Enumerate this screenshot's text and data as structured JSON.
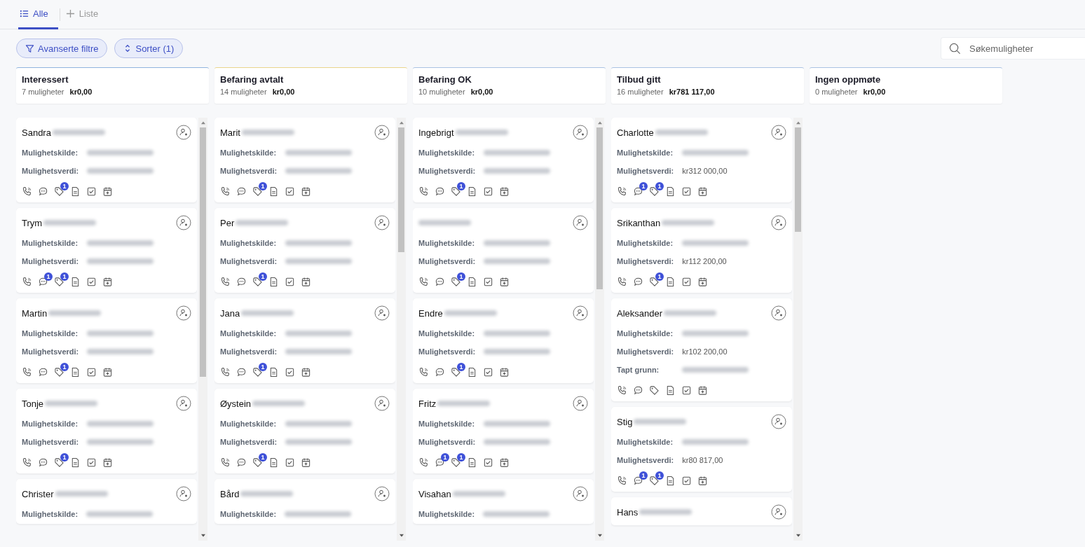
{
  "tabs": [
    {
      "label": "Alle",
      "kind": "list",
      "selected": true
    },
    {
      "label": "Liste",
      "kind": "add",
      "selected": false
    }
  ],
  "toolbar": {
    "buttons": [
      {
        "label": "Avanserte filtre",
        "kind": "filter"
      },
      {
        "label": "Sorter (1)",
        "kind": "sort"
      }
    ],
    "search": {
      "placeholder": "Søkemuligheter"
    }
  },
  "columns": [
    {
      "title": "Interessert",
      "count": "7 muligheter",
      "total": "kr0,00",
      "color": "#8fb4de",
      "cards": [
        {
          "name": "Sandra",
          "fields": [
            {
              "label": "Mulighetskilde:"
            },
            {
              "label": "Mulighetsverdi:"
            }
          ],
          "actions": [
            {
              "kind": "call"
            },
            {
              "kind": "chat"
            },
            {
              "kind": "tag",
              "badge": "1"
            },
            {
              "kind": "note"
            },
            {
              "kind": "task"
            },
            {
              "kind": "event"
            }
          ]
        },
        {
          "name": "Trym",
          "fields": [
            {
              "label": "Mulighetskilde:"
            },
            {
              "label": "Mulighetsverdi:"
            }
          ],
          "actions": [
            {
              "kind": "call"
            },
            {
              "kind": "chat",
              "badge": "1"
            },
            {
              "kind": "tag",
              "badge": "1"
            },
            {
              "kind": "note"
            },
            {
              "kind": "task"
            },
            {
              "kind": "event"
            }
          ]
        },
        {
          "name": "Martin",
          "fields": [
            {
              "label": "Mulighetskilde:"
            },
            {
              "label": "Mulighetsverdi:"
            }
          ],
          "actions": [
            {
              "kind": "call"
            },
            {
              "kind": "chat"
            },
            {
              "kind": "tag",
              "badge": "1"
            },
            {
              "kind": "note"
            },
            {
              "kind": "task"
            },
            {
              "kind": "event"
            }
          ]
        },
        {
          "name": "Tonje",
          "fields": [
            {
              "label": "Mulighetskilde:"
            },
            {
              "label": "Mulighetsverdi:"
            }
          ],
          "actions": [
            {
              "kind": "call"
            },
            {
              "kind": "chat"
            },
            {
              "kind": "tag",
              "badge": "1"
            },
            {
              "kind": "note"
            },
            {
              "kind": "task"
            },
            {
              "kind": "event"
            }
          ]
        },
        {
          "name": "Christer",
          "fields": [
            {
              "label": "Mulighetskilde:"
            }
          ]
        }
      ]
    },
    {
      "title": "Befaring avtalt",
      "count": "14 muligheter",
      "total": "kr0,00",
      "color": "#e9d58c",
      "cards": [
        {
          "name": "Marit",
          "fields": [
            {
              "label": "Mulighetskilde:"
            },
            {
              "label": "Mulighetsverdi:"
            }
          ],
          "actions": [
            {
              "kind": "call"
            },
            {
              "kind": "chat"
            },
            {
              "kind": "tag",
              "badge": "1"
            },
            {
              "kind": "note"
            },
            {
              "kind": "task"
            },
            {
              "kind": "event"
            }
          ]
        },
        {
          "name": "Per",
          "fields": [
            {
              "label": "Mulighetskilde:"
            },
            {
              "label": "Mulighetsverdi:"
            }
          ],
          "actions": [
            {
              "kind": "call"
            },
            {
              "kind": "chat"
            },
            {
              "kind": "tag",
              "badge": "1"
            },
            {
              "kind": "note"
            },
            {
              "kind": "task"
            },
            {
              "kind": "event"
            }
          ]
        },
        {
          "name": "Jana",
          "fields": [
            {
              "label": "Mulighetskilde:"
            },
            {
              "label": "Mulighetsverdi:"
            }
          ],
          "actions": [
            {
              "kind": "call"
            },
            {
              "kind": "chat"
            },
            {
              "kind": "tag",
              "badge": "1"
            },
            {
              "kind": "note"
            },
            {
              "kind": "task"
            },
            {
              "kind": "event"
            }
          ]
        },
        {
          "name": "Øystein",
          "fields": [
            {
              "label": "Mulighetskilde:"
            },
            {
              "label": "Mulighetsverdi:"
            }
          ],
          "actions": [
            {
              "kind": "call"
            },
            {
              "kind": "chat"
            },
            {
              "kind": "tag",
              "badge": "1"
            },
            {
              "kind": "note"
            },
            {
              "kind": "task"
            },
            {
              "kind": "event"
            }
          ]
        },
        {
          "name": "Bård",
          "fields": [
            {
              "label": "Mulighetskilde:"
            }
          ]
        }
      ]
    },
    {
      "title": "Befaring OK",
      "count": "10 muligheter",
      "total": "kr0,00",
      "color": "#a9c2e2",
      "cards": [
        {
          "name": "Ingebrigt",
          "fields": [
            {
              "label": "Mulighetskilde:"
            },
            {
              "label": "Mulighetsverdi:"
            }
          ],
          "actions": [
            {
              "kind": "call"
            },
            {
              "kind": "chat"
            },
            {
              "kind": "tag",
              "badge": "1"
            },
            {
              "kind": "note"
            },
            {
              "kind": "task"
            },
            {
              "kind": "event"
            }
          ]
        },
        {
          "fields": [
            {
              "label": "Mulighetskilde:"
            },
            {
              "label": "Mulighetsverdi:"
            }
          ],
          "actions": [
            {
              "kind": "call"
            },
            {
              "kind": "chat"
            },
            {
              "kind": "tag",
              "badge": "1"
            },
            {
              "kind": "note"
            },
            {
              "kind": "task"
            },
            {
              "kind": "event"
            }
          ]
        },
        {
          "name": "Endre",
          "fields": [
            {
              "label": "Mulighetskilde:"
            },
            {
              "label": "Mulighetsverdi:"
            }
          ],
          "actions": [
            {
              "kind": "call"
            },
            {
              "kind": "chat"
            },
            {
              "kind": "tag",
              "badge": "1"
            },
            {
              "kind": "note"
            },
            {
              "kind": "task"
            },
            {
              "kind": "event"
            }
          ]
        },
        {
          "name": "Fritz",
          "fields": [
            {
              "label": "Mulighetskilde:"
            },
            {
              "label": "Mulighetsverdi:"
            }
          ],
          "actions": [
            {
              "kind": "call"
            },
            {
              "kind": "chat",
              "badge": "1"
            },
            {
              "kind": "tag",
              "badge": "1"
            },
            {
              "kind": "note"
            },
            {
              "kind": "task"
            },
            {
              "kind": "event"
            }
          ]
        },
        {
          "name": "Visahan",
          "fields": [
            {
              "label": "Mulighetskilde:"
            }
          ]
        }
      ]
    },
    {
      "title": "Tilbud gitt",
      "count": "16 muligheter",
      "total": "kr781 117,00",
      "color": "#a9c2e2",
      "cards": [
        {
          "name": "Charlotte",
          "fields": [
            {
              "label": "Mulighetskilde:"
            },
            {
              "label": "Mulighetsverdi:",
              "value": "kr312 000,00"
            }
          ],
          "actions": [
            {
              "kind": "call"
            },
            {
              "kind": "chat",
              "badge": "1"
            },
            {
              "kind": "tag",
              "badge": "1"
            },
            {
              "kind": "note"
            },
            {
              "kind": "task"
            },
            {
              "kind": "event"
            }
          ]
        },
        {
          "name": "Srikanthan",
          "fields": [
            {
              "label": "Mulighetskilde:"
            },
            {
              "label": "Mulighetsverdi:",
              "value": "kr112 200,00"
            }
          ],
          "actions": [
            {
              "kind": "call"
            },
            {
              "kind": "chat"
            },
            {
              "kind": "tag",
              "badge": "1"
            },
            {
              "kind": "note"
            },
            {
              "kind": "task"
            },
            {
              "kind": "event"
            }
          ]
        },
        {
          "name": "Aleksander",
          "fields": [
            {
              "label": "Mulighetskilde:"
            },
            {
              "label": "Mulighetsverdi:",
              "value": "kr102 200,00"
            },
            {
              "label": "Tapt grunn:"
            }
          ],
          "actions": [
            {
              "kind": "call"
            },
            {
              "kind": "chat"
            },
            {
              "kind": "tag"
            },
            {
              "kind": "note"
            },
            {
              "kind": "task"
            },
            {
              "kind": "event"
            }
          ]
        },
        {
          "name": "Stig",
          "fields": [
            {
              "label": "Mulighetskilde:"
            },
            {
              "label": "Mulighetsverdi:",
              "value": "kr80 817,00"
            }
          ],
          "actions": [
            {
              "kind": "call"
            },
            {
              "kind": "chat",
              "badge": "1"
            },
            {
              "kind": "tag",
              "badge": "1"
            },
            {
              "kind": "note"
            },
            {
              "kind": "task"
            },
            {
              "kind": "event"
            }
          ]
        },
        {
          "name": "Hans"
        }
      ]
    },
    {
      "title": "Ingen oppmøte",
      "count": "0 muligheter",
      "total": "kr0,00",
      "color": "#a9c2e2"
    }
  ]
}
